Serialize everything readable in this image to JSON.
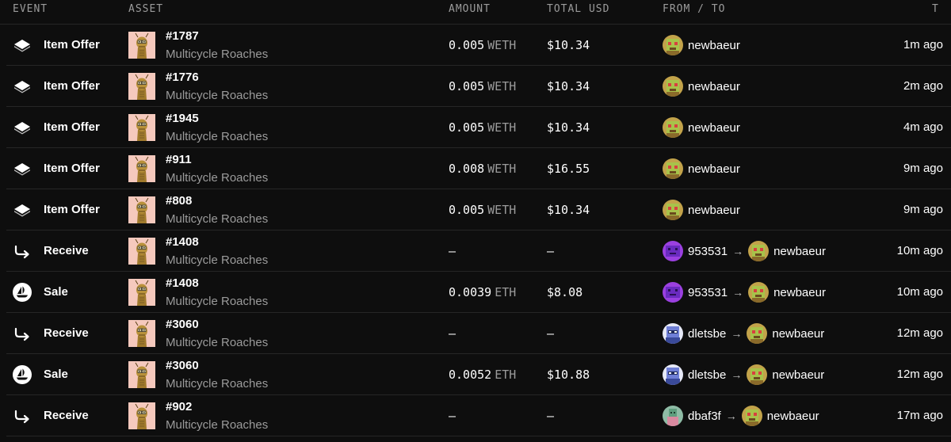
{
  "header": {
    "event": "EVENT",
    "asset": "ASSET",
    "amount": "AMOUNT",
    "total_usd": "TOTAL USD",
    "from_to": "FROM / TO",
    "time": "T"
  },
  "icons": {
    "item_offer": "layers-icon",
    "receive": "transfer-arrow-icon",
    "sale": "opensea-sailboat-icon",
    "nft": "roach-nft-thumbnail",
    "avatar": "pixel-avatar"
  },
  "colors": {
    "background": "#0e0e0e",
    "divider": "#262626",
    "muted_text": "#9b9b9b",
    "thumb_bg": "#f5c9bd",
    "avatar_newbaeur": "#c2a34a",
    "avatar_953531": "#9b40e0",
    "avatar_dletsbe": "#6f7fd6",
    "avatar_dbaf3f": "#8fbca6"
  },
  "rows": [
    {
      "event": "Item Offer",
      "type": "offer",
      "asset_id": "#1787",
      "collection": "Multicycle Roaches",
      "amount": "0.005",
      "unit": "WETH",
      "usd": "$10.34",
      "from": "newbaeur",
      "from_avatar": "newbaeur",
      "to": "",
      "time": "1m ago"
    },
    {
      "event": "Item Offer",
      "type": "offer",
      "asset_id": "#1776",
      "collection": "Multicycle Roaches",
      "amount": "0.005",
      "unit": "WETH",
      "usd": "$10.34",
      "from": "newbaeur",
      "from_avatar": "newbaeur",
      "to": "",
      "time": "2m ago"
    },
    {
      "event": "Item Offer",
      "type": "offer",
      "asset_id": "#1945",
      "collection": "Multicycle Roaches",
      "amount": "0.005",
      "unit": "WETH",
      "usd": "$10.34",
      "from": "newbaeur",
      "from_avatar": "newbaeur",
      "to": "",
      "time": "4m ago"
    },
    {
      "event": "Item Offer",
      "type": "offer",
      "asset_id": "#911",
      "collection": "Multicycle Roaches",
      "amount": "0.008",
      "unit": "WETH",
      "usd": "$16.55",
      "from": "newbaeur",
      "from_avatar": "newbaeur",
      "to": "",
      "time": "9m ago"
    },
    {
      "event": "Item Offer",
      "type": "offer",
      "asset_id": "#808",
      "collection": "Multicycle Roaches",
      "amount": "0.005",
      "unit": "WETH",
      "usd": "$10.34",
      "from": "newbaeur",
      "from_avatar": "newbaeur",
      "to": "",
      "time": "9m ago"
    },
    {
      "event": "Receive",
      "type": "receive",
      "asset_id": "#1408",
      "collection": "Multicycle Roaches",
      "amount": "—",
      "unit": "",
      "usd": "—",
      "from": "953531",
      "from_avatar": "953531",
      "to": "newbaeur",
      "time": "10m ago"
    },
    {
      "event": "Sale",
      "type": "sale",
      "asset_id": "#1408",
      "collection": "Multicycle Roaches",
      "amount": "0.0039",
      "unit": "ETH",
      "usd": "$8.08",
      "from": "953531",
      "from_avatar": "953531",
      "to": "newbaeur",
      "time": "10m ago"
    },
    {
      "event": "Receive",
      "type": "receive",
      "asset_id": "#3060",
      "collection": "Multicycle Roaches",
      "amount": "—",
      "unit": "",
      "usd": "—",
      "from": "dletsbe",
      "from_avatar": "dletsbe",
      "to": "newbaeur",
      "time": "12m ago"
    },
    {
      "event": "Sale",
      "type": "sale",
      "asset_id": "#3060",
      "collection": "Multicycle Roaches",
      "amount": "0.0052",
      "unit": "ETH",
      "usd": "$10.88",
      "from": "dletsbe",
      "from_avatar": "dletsbe",
      "to": "newbaeur",
      "time": "12m ago"
    },
    {
      "event": "Receive",
      "type": "receive",
      "asset_id": "#902",
      "collection": "Multicycle Roaches",
      "amount": "—",
      "unit": "",
      "usd": "—",
      "from": "dbaf3f",
      "from_avatar": "dbaf3f",
      "to": "newbaeur",
      "time": "17m ago"
    }
  ]
}
